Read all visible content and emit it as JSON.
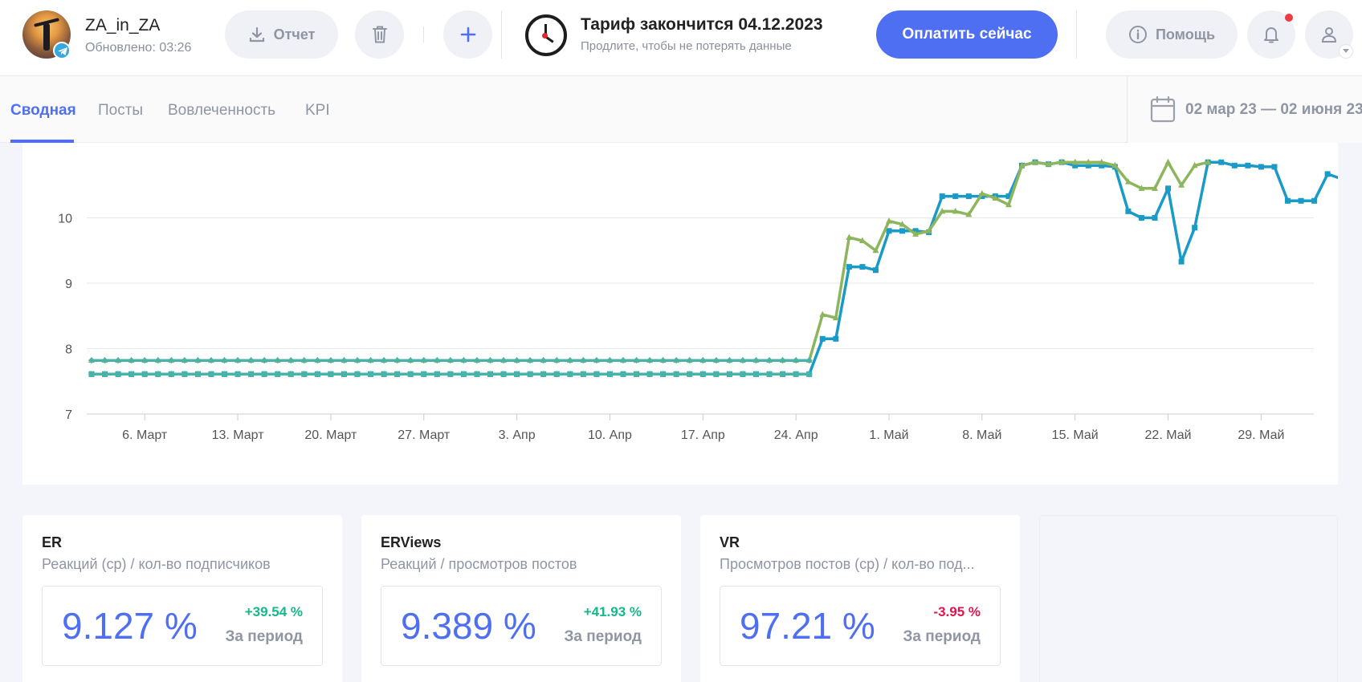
{
  "account": {
    "name": "ZA_in_ZA",
    "updated": "Обновлено: 03:26"
  },
  "toolbar": {
    "report_label": "Отчет"
  },
  "tariff": {
    "title": "Тариф закончится 04.12.2023",
    "subtitle": "Продлите, чтобы не потерять данные"
  },
  "pay_button": {
    "label": "Оплатить сейчас"
  },
  "help_button": {
    "label": "Помощь"
  },
  "tabs": [
    {
      "label": "Сводная",
      "active": true
    },
    {
      "label": "Посты",
      "active": false
    },
    {
      "label": "Вовлеченность",
      "active": false
    },
    {
      "label": "KPI",
      "active": false
    }
  ],
  "date_range": "02 мар 23 — 02 июня 23",
  "colors": {
    "accent": "#4f6ff2",
    "series_blue": "#1a9ac6",
    "series_green": "#8db55c",
    "series_teal": "#49b3a8",
    "positive": "#16b88a",
    "negative": "#e0174a"
  },
  "chart_data": {
    "type": "line",
    "y_ticks": [
      "7",
      "8",
      "9",
      "10"
    ],
    "ylim": [
      7,
      10.8
    ],
    "x_ticks": [
      "6. Март",
      "13. Март",
      "20. Март",
      "27. Март",
      "3. Апр",
      "10. Апр",
      "17. Апр",
      "24. Апр",
      "1. Май",
      "8. Май",
      "15. Май",
      "22. Май",
      "29. Май"
    ],
    "x_tick_days": [
      4,
      11,
      18,
      25,
      32,
      39,
      46,
      53,
      60,
      67,
      74,
      81,
      88
    ],
    "x_range": [
      0,
      92
    ],
    "series": [
      {
        "color": "#1a9ac6",
        "points": [
          [
            0,
            7.61
          ],
          [
            54,
            7.61
          ],
          [
            55,
            8.15
          ],
          [
            56,
            8.15
          ],
          [
            57,
            9.25
          ],
          [
            58,
            9.25
          ],
          [
            59,
            9.2
          ],
          [
            60,
            9.8
          ],
          [
            61,
            9.8
          ],
          [
            62,
            9.8
          ],
          [
            63,
            9.78
          ],
          [
            64,
            10.33
          ],
          [
            65,
            10.33
          ],
          [
            66,
            10.33
          ],
          [
            67,
            10.33
          ],
          [
            68,
            10.33
          ],
          [
            69,
            10.33
          ],
          [
            70,
            10.8
          ],
          [
            71,
            10.85
          ],
          [
            72,
            10.82
          ],
          [
            73,
            10.85
          ],
          [
            74,
            10.8
          ],
          [
            75,
            10.8
          ],
          [
            76,
            10.8
          ],
          [
            77,
            10.78
          ],
          [
            78,
            10.1
          ],
          [
            79,
            10.0
          ],
          [
            80,
            10.0
          ],
          [
            81,
            10.45
          ],
          [
            82,
            9.33
          ],
          [
            83,
            9.85
          ],
          [
            84,
            10.85
          ],
          [
            85,
            10.85
          ],
          [
            86,
            10.8
          ],
          [
            87,
            10.8
          ],
          [
            88,
            10.78
          ],
          [
            89,
            10.78
          ],
          [
            90,
            10.26
          ],
          [
            91,
            10.26
          ],
          [
            92,
            10.26
          ],
          [
            93,
            10.67
          ],
          [
            94,
            10.6
          ]
        ]
      },
      {
        "color": "#8db55c",
        "points": [
          [
            0,
            7.82
          ],
          [
            54,
            7.82
          ],
          [
            55,
            8.52
          ],
          [
            56,
            8.47
          ],
          [
            57,
            9.7
          ],
          [
            58,
            9.65
          ],
          [
            59,
            9.5
          ],
          [
            60,
            9.95
          ],
          [
            61,
            9.9
          ],
          [
            62,
            9.75
          ],
          [
            63,
            9.8
          ],
          [
            64,
            10.1
          ],
          [
            65,
            10.1
          ],
          [
            66,
            10.05
          ],
          [
            67,
            10.37
          ],
          [
            68,
            10.3
          ],
          [
            69,
            10.2
          ],
          [
            70,
            10.8
          ],
          [
            71,
            10.85
          ],
          [
            72,
            10.82
          ],
          [
            73,
            10.85
          ],
          [
            74,
            10.85
          ],
          [
            75,
            10.85
          ],
          [
            76,
            10.85
          ],
          [
            77,
            10.8
          ],
          [
            78,
            10.55
          ],
          [
            79,
            10.45
          ],
          [
            80,
            10.45
          ],
          [
            81,
            10.85
          ],
          [
            82,
            10.5
          ],
          [
            83,
            10.8
          ],
          [
            84,
            10.85
          ]
        ]
      },
      {
        "color": "#49b3a8",
        "points": [
          [
            0,
            7.82
          ],
          [
            54,
            7.82
          ]
        ]
      },
      {
        "color": "#49b3a8",
        "points": [
          [
            0,
            7.61
          ],
          [
            54,
            7.61
          ]
        ]
      }
    ]
  },
  "cards": [
    {
      "title": "ER",
      "subtitle": "Реакций (ср) / кол-во подписчиков",
      "value": "9.127 %",
      "delta": "+39.54 %",
      "delta_sign": "pos",
      "period": "За период"
    },
    {
      "title": "ERViews",
      "subtitle": "Реакций / просмотров постов",
      "value": "9.389 %",
      "delta": "+41.93 %",
      "delta_sign": "pos",
      "period": "За период"
    },
    {
      "title": "VR",
      "subtitle": "Просмотров постов (ср) / кол-во под...",
      "value": "97.21 %",
      "delta": "-3.95 %",
      "delta_sign": "neg",
      "period": "За период"
    }
  ]
}
